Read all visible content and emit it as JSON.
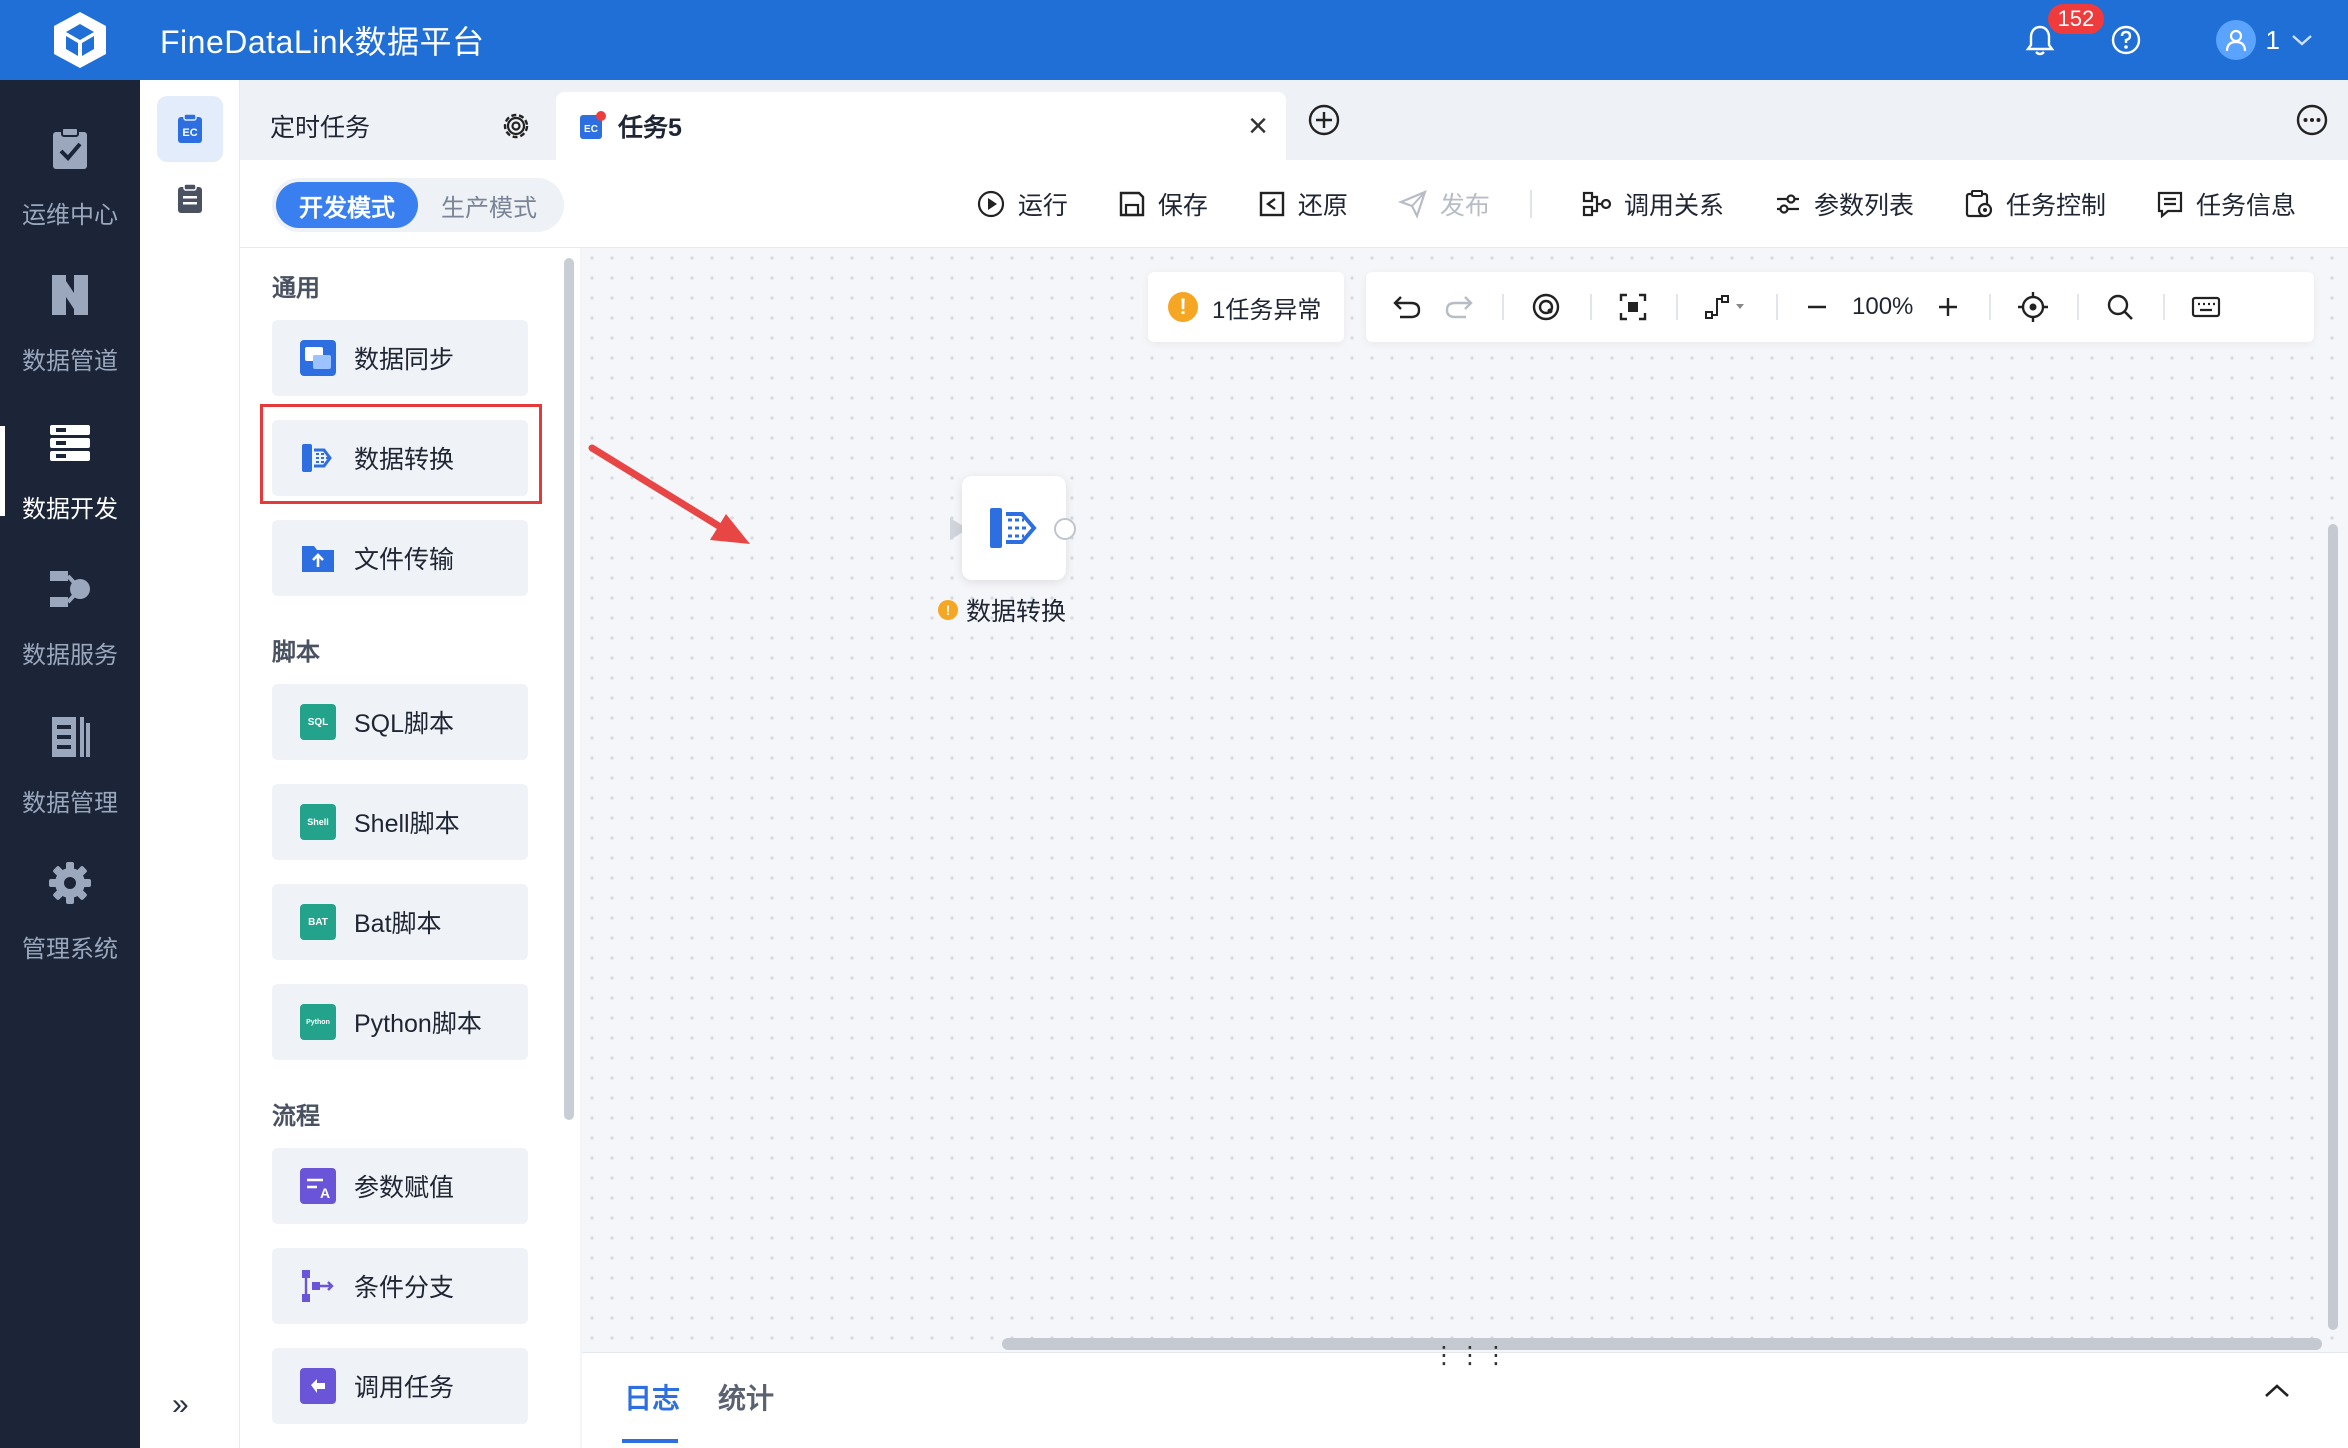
{
  "app": {
    "title": "FineDataLink数据平台",
    "notification_count": "152",
    "user_name": "1"
  },
  "leftnav": [
    {
      "label": "运维中心",
      "icon": "clipboard-check-icon"
    },
    {
      "label": "数据管道",
      "icon": "pipeline-icon"
    },
    {
      "label": "数据开发",
      "icon": "dev-stack-icon",
      "active": true
    },
    {
      "label": "数据服务",
      "icon": "service-icon"
    },
    {
      "label": "数据管理",
      "icon": "manage-icon"
    },
    {
      "label": "管理系统",
      "icon": "gear-icon"
    }
  ],
  "tabs": {
    "timed": "定时任务",
    "task": "任务5"
  },
  "toolbar": {
    "mode_dev": "开发模式",
    "mode_prod": "生产模式",
    "run": "运行",
    "save": "保存",
    "restore": "还原",
    "publish": "发布",
    "call_relation": "调用关系",
    "param_list": "参数列表",
    "task_control": "任务控制",
    "task_info": "任务信息"
  },
  "panel": {
    "sections": {
      "general": "通用",
      "script": "脚本",
      "flow": "流程"
    },
    "general": [
      "数据同步",
      "数据转换",
      "文件传输"
    ],
    "script": [
      "SQL脚本",
      "Shell脚本",
      "Bat脚本",
      "Python脚本"
    ],
    "flow": [
      "参数赋值",
      "条件分支",
      "调用任务"
    ]
  },
  "canvas": {
    "alert": "1任务异常",
    "zoom": "100%",
    "node_label": "数据转换"
  },
  "log": {
    "tab_log": "日志",
    "tab_stats": "统计"
  },
  "colors": {
    "brand": "#1f6fd6",
    "nav_bg": "#1b2537",
    "accent": "#3a7ff0",
    "highlight": "#e53a3a",
    "warning": "#f5a623"
  }
}
